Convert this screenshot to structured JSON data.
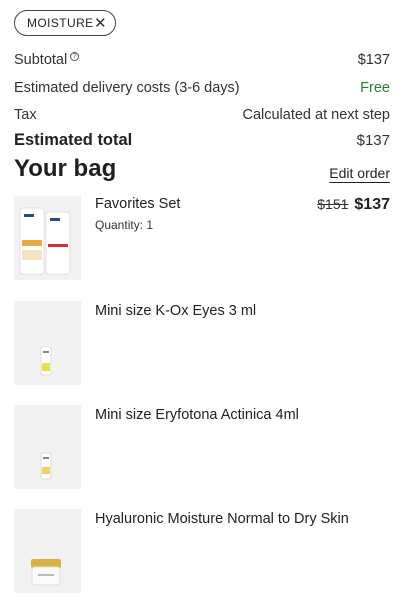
{
  "filter_chip": {
    "label": "MOISTURE"
  },
  "summary": {
    "subtotal_label": "Subtotal",
    "subtotal_value": "$137",
    "delivery_label": "Estimated delivery costs (3-6 days)",
    "delivery_value": "Free",
    "tax_label": "Tax",
    "tax_value": "Calculated at next step",
    "total_label": "Estimated total",
    "total_value": "$137"
  },
  "bag": {
    "title": "Your bag",
    "edit_label": "Edit order",
    "items": [
      {
        "name": "Favorites Set",
        "quantity": "Quantity: 1",
        "old_price": "$151",
        "price": "$137"
      },
      {
        "name": "Mini size K-Ox Eyes 3 ml"
      },
      {
        "name": "Mini size Eryfotona Actinica 4ml"
      },
      {
        "name": "Hyaluronic Moisture Normal to Dry Skin"
      }
    ]
  },
  "colors": {
    "free": "#2e7d32",
    "thumb_bg": "#f2f2f2"
  }
}
